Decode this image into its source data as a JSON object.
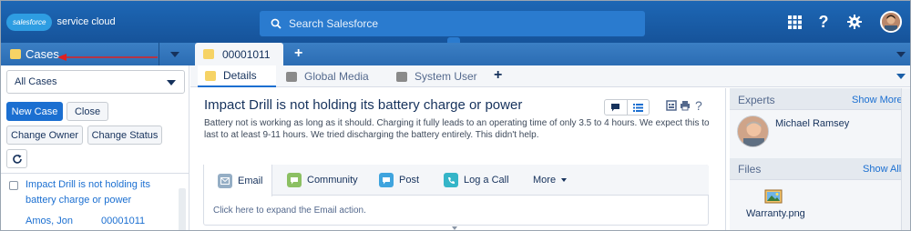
{
  "header": {
    "logo_cloud": "salesforce",
    "logo_text": "service cloud",
    "search_placeholder": "Search Salesforce",
    "icons": [
      "apps-grid-icon",
      "help-icon",
      "settings-gear-icon",
      "user-avatar"
    ]
  },
  "left_panel": {
    "title": "Cases",
    "list_view": "All Cases",
    "buttons": {
      "new_case": "New Case",
      "close": "Close",
      "change_owner": "Change Owner",
      "change_status": "Change Status"
    },
    "rows": [
      {
        "subject": "Impact Drill is not holding its battery charge or power",
        "owner": "Amos, Jon",
        "case_number": "00001011"
      }
    ]
  },
  "tabs": {
    "primary": "00001011",
    "subtabs": [
      "Details",
      "Global Media",
      "System User"
    ]
  },
  "case": {
    "title": "Impact Drill is not holding its battery charge or power",
    "description": "Battery not is working as long as it should. Charging it fully leads to an operating time of only 3.5 to 4 hours. We expect this to last to at least 9-11 hours. We tried discharging the battery entirely. This didn't help.",
    "help": "?"
  },
  "publisher": {
    "tabs": [
      "Email",
      "Community",
      "Post",
      "Log a Call",
      "More"
    ],
    "hint": "Click here to expand the Email action."
  },
  "sidebar": {
    "experts_title": "Experts",
    "experts_link": "Show More",
    "expert_name": "Michael Ramsey",
    "files_title": "Files",
    "files_link": "Show All",
    "file_name": "Warranty.png"
  },
  "colors": {
    "brand_blue": "#1b5fa8",
    "link_blue": "#1b6fd1",
    "arrow_red": "#e02020"
  }
}
